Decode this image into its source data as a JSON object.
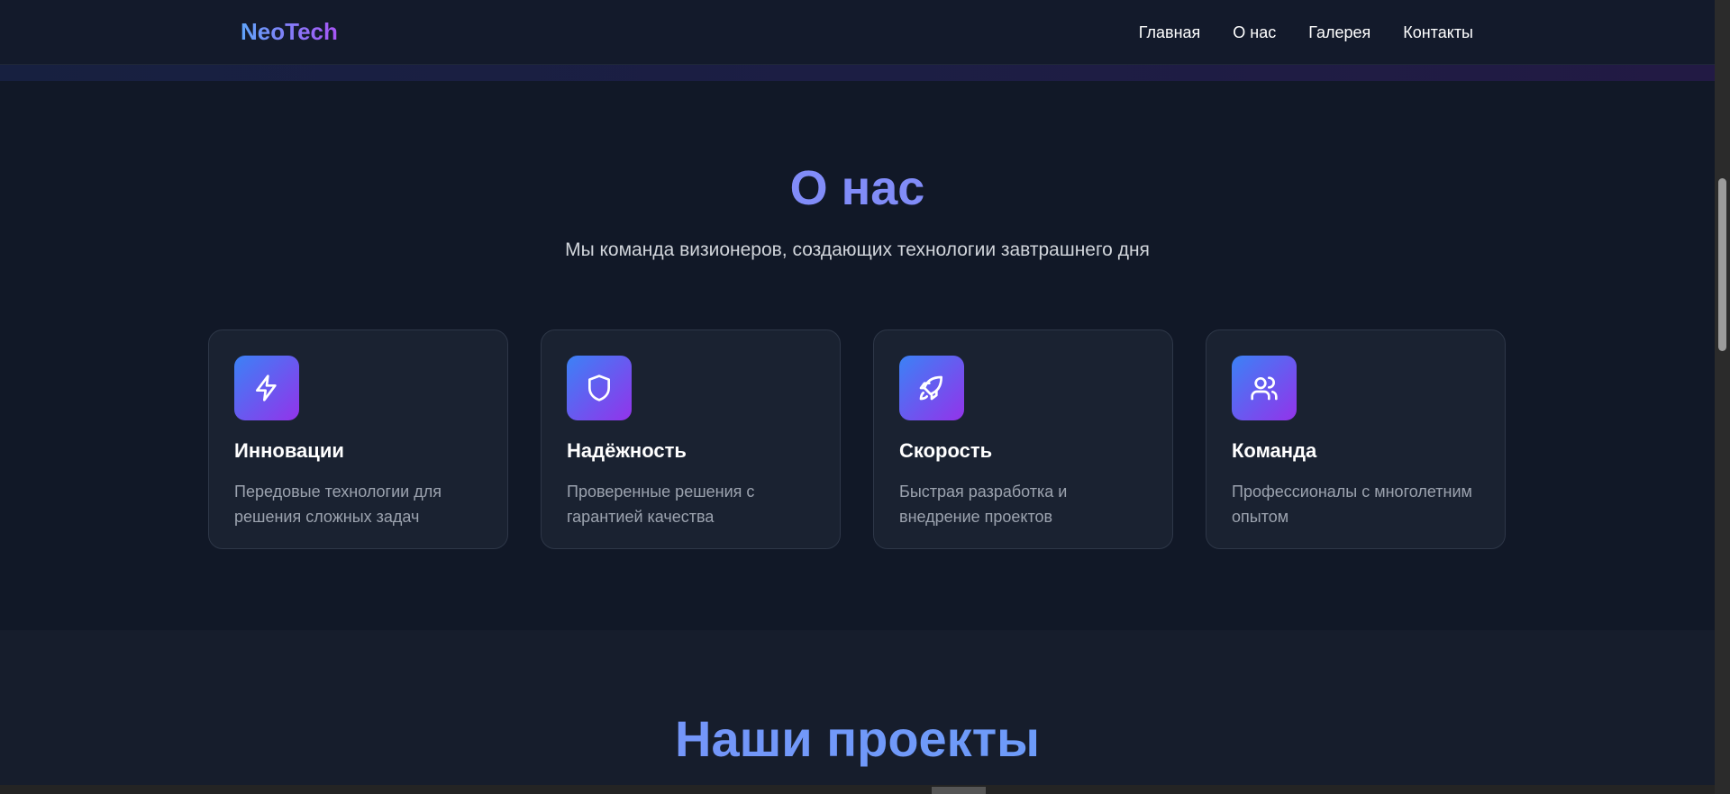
{
  "header": {
    "logo": "NeoTech",
    "nav": [
      "Главная",
      "О нас",
      "Галерея",
      "Контакты"
    ]
  },
  "about": {
    "title": "О нас",
    "subtitle": "Мы команда визионеров, создающих технологии завтрашнего дня",
    "cards": [
      {
        "icon": "lightning-icon",
        "title": "Инновации",
        "text": "Передовые технологии для решения сложных задач"
      },
      {
        "icon": "shield-icon",
        "title": "Надёжность",
        "text": "Проверенные решения с гарантией качества"
      },
      {
        "icon": "rocket-icon",
        "title": "Скорость",
        "text": "Быстрая разработка и внедрение проектов"
      },
      {
        "icon": "users-icon",
        "title": "Команда",
        "text": "Профессионалы с многолетним опытом"
      }
    ]
  },
  "projects": {
    "title": "Наши проекты"
  }
}
